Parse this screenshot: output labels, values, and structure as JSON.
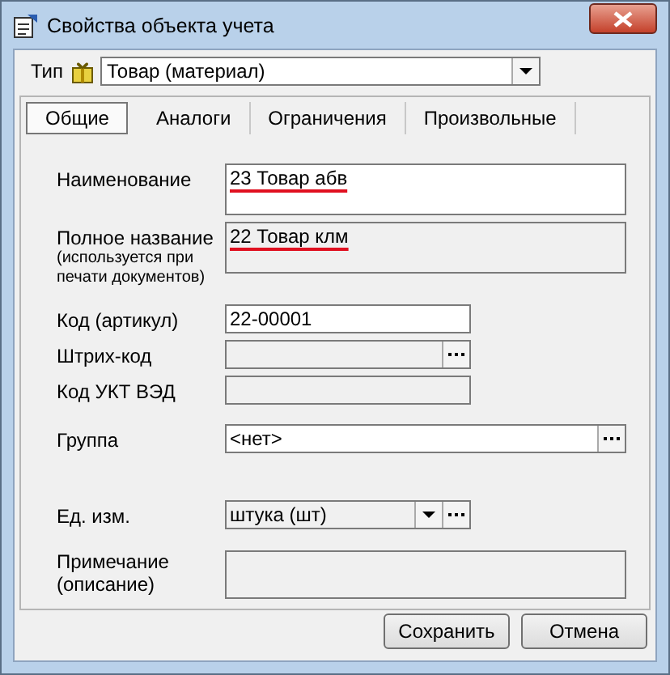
{
  "window": {
    "title": "Свойства объекта учета"
  },
  "type_field": {
    "label": "Тип",
    "value": "Товар (материал)"
  },
  "tabs": [
    {
      "label": "Общие",
      "selected": true
    },
    {
      "label": "Аналоги",
      "selected": false
    },
    {
      "label": "Ограничения",
      "selected": false
    },
    {
      "label": "Произвольные",
      "selected": false
    }
  ],
  "fields": [
    {
      "kind": "multiline",
      "label": "Наименование",
      "value": "23 Товар абв",
      "editable": true,
      "misspelled": true
    },
    {
      "kind": "multiline",
      "label": "Полное название",
      "note": "(используется при печати документов)",
      "value": "22 Товар клм",
      "editable": false,
      "misspelled": true
    },
    {
      "kind": "text",
      "label": "Код (артикул)",
      "value": "22-00001",
      "editable": true,
      "misspelled": false
    },
    {
      "kind": "picker",
      "label": "Штрих-код",
      "editable": false
    },
    {
      "kind": "text",
      "label": "Код УКТ ВЭД",
      "editable": false
    },
    {
      "kind": "wide_picker",
      "label": "Группа",
      "value": "<нет>",
      "editable": true,
      "misspelled": false
    },
    {
      "kind": "combo",
      "label": "Ед. изм.",
      "value": "штука (шт)",
      "editable": false,
      "misspelled": false
    },
    {
      "kind": "note",
      "label": "Примечание (описание)",
      "editable": false
    }
  ],
  "buttons": [
    "Сохранить",
    "Отмена"
  ]
}
